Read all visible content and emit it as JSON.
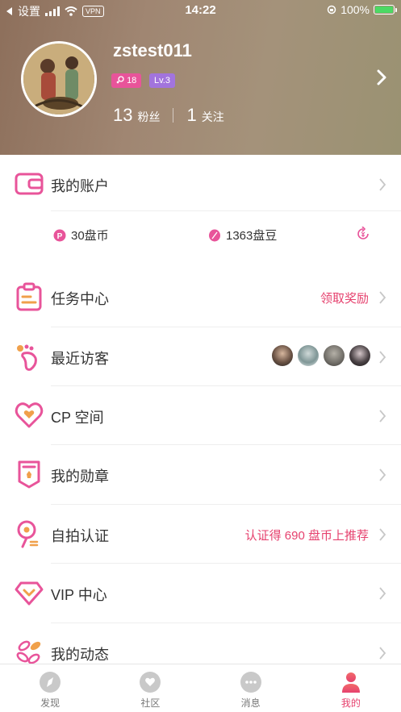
{
  "status_bar": {
    "back_label": "设置",
    "vpn": "VPN",
    "time": "14:22",
    "battery": "100%"
  },
  "profile": {
    "username": "zstest011",
    "badge_level_1": "18",
    "badge_level_2": "Lv.3",
    "fans_count": "13",
    "fans_label": "粉丝",
    "follow_count": "1",
    "follow_label": "关注"
  },
  "account": {
    "label": "我的账户",
    "coins": "30盘币",
    "beans": "1363盘豆"
  },
  "menu": [
    {
      "label": "任务中心",
      "right_text": "领取奖励"
    },
    {
      "label": "最近访客",
      "right_text": ""
    },
    {
      "label": "CP 空间",
      "right_text": ""
    },
    {
      "label": "我的勋章",
      "right_text": ""
    },
    {
      "label": "自拍认证",
      "right_text": "认证得 690 盘币上推荐"
    },
    {
      "label": "VIP 中心",
      "right_text": ""
    },
    {
      "label": "我的动态",
      "right_text": ""
    }
  ],
  "tabbar": [
    {
      "label": "发现"
    },
    {
      "label": "社区"
    },
    {
      "label": "消息"
    },
    {
      "label": "我的"
    }
  ],
  "colors": {
    "accent": "#e6416e",
    "icon_pink": "#e8549a",
    "icon_orange": "#f0a04b"
  },
  "icons": {
    "wallet": "wallet-icon",
    "task": "clipboard-icon",
    "visitors": "footprint-icon",
    "cp": "heart-icon",
    "medal": "medal-icon",
    "selfie": "selfie-icon",
    "vip": "diamond-icon",
    "moments": "flower-icon"
  }
}
